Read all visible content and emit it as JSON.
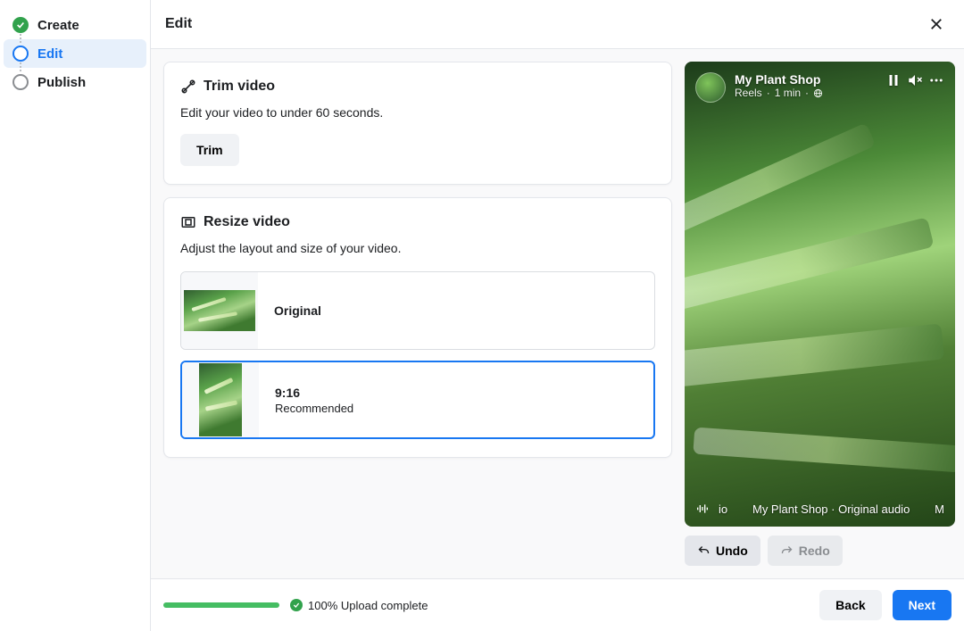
{
  "header": {
    "title": "Edit"
  },
  "steps": {
    "create": "Create",
    "edit": "Edit",
    "publish": "Publish"
  },
  "trim": {
    "title": "Trim video",
    "desc": "Edit your video to under 60 seconds.",
    "button": "Trim"
  },
  "resize": {
    "title": "Resize video",
    "desc": "Adjust the layout and size of your video.",
    "option_original": "Original",
    "option_ratio": "9:16",
    "option_reco": "Recommended"
  },
  "preview": {
    "name": "My Plant Shop",
    "meta_kind": "Reels",
    "meta_time": "1 min",
    "audio_prefix": "io",
    "audio_text": "My Plant Shop · Original audio",
    "audio_suffix": "M"
  },
  "actions": {
    "undo": "Undo",
    "redo": "Redo"
  },
  "footer": {
    "upload": "100% Upload complete",
    "back": "Back",
    "next": "Next"
  }
}
